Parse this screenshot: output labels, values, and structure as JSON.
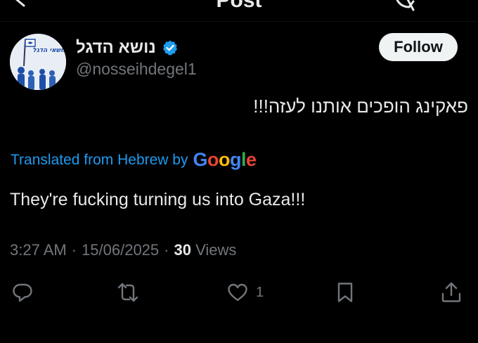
{
  "header": {
    "title": "Post"
  },
  "author": {
    "display_name": "נושא הדגל",
    "handle": "@nosseihdegel1",
    "verified": true,
    "avatar_text": "נושאי הדגל"
  },
  "follow_button": {
    "label": "Follow"
  },
  "post": {
    "original_text": "פאקינג הופכים אותנו לעזה!!!",
    "translation_label": "Translated from Hebrew by",
    "translation_provider": "Google",
    "translated_text": "They're fucking turning us into Gaza!!!"
  },
  "meta": {
    "time": "3:27 AM",
    "date": "15/06/2025",
    "separator": "·",
    "views_count": "30",
    "views_label": "Views"
  },
  "actions": {
    "like_count": "1"
  },
  "colors": {
    "background": "#000000",
    "text": "#e7e9ea",
    "muted": "#71767b",
    "accent": "#1d9bf0",
    "follow_bg": "#eff3f4"
  }
}
